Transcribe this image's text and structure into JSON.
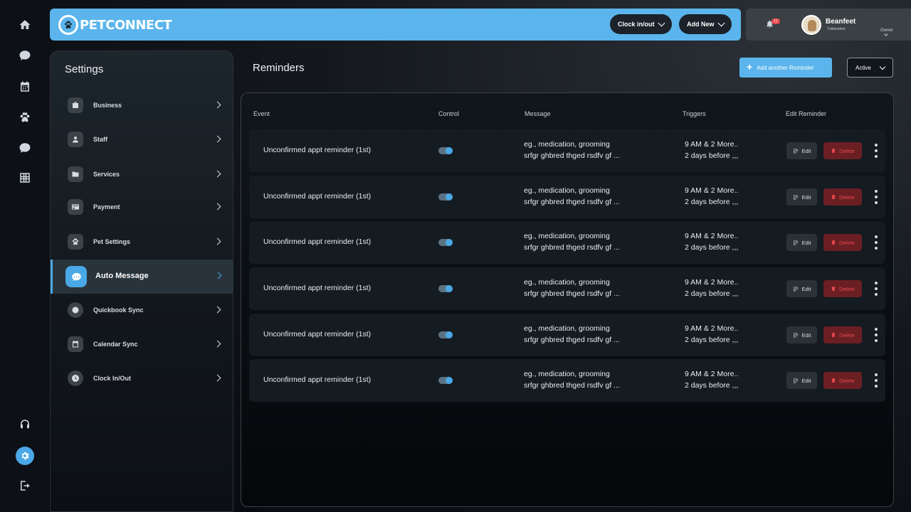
{
  "app": {
    "logo_text_1": "PET",
    "logo_text_2": "CONNECT",
    "accent": "#5bb5ec",
    "danger": "#e5484d"
  },
  "topbar": {
    "clock_label": "Clock in/out",
    "add_new_label": "Add New"
  },
  "user": {
    "notification_count": "12",
    "name": "Beanfeet",
    "location": "Tullamarine",
    "role": "Owner"
  },
  "rail": {
    "icons": [
      "home-icon",
      "chat-icon",
      "calendar-icon",
      "paw-icon",
      "sms-icon",
      "grid-icon",
      "headset-icon",
      "settings-icon",
      "logout-icon"
    ]
  },
  "settings": {
    "title": "Settings",
    "items": [
      {
        "label": "Business",
        "icon": "briefcase-icon"
      },
      {
        "label": "Staff",
        "icon": "person-icon"
      },
      {
        "label": "Services",
        "icon": "folder-icon"
      },
      {
        "label": "Payment",
        "icon": "card-icon"
      },
      {
        "label": "Pet Settings",
        "icon": "paw-icon"
      },
      {
        "label": "Auto Message",
        "icon": "message-icon",
        "active": true
      },
      {
        "label": "Quickbook Sync",
        "icon": "quickbooks-icon"
      },
      {
        "label": "Calendar Sync",
        "icon": "calendar-icon"
      },
      {
        "label": "Clock In/Out",
        "icon": "clock-icon"
      }
    ]
  },
  "reminders": {
    "title": "Reminders",
    "add_label": "Add another Reminder",
    "status_value": "Active",
    "headers": {
      "event": "Event",
      "control": "Control",
      "message": "Message",
      "triggers": "Triggers",
      "edit": "Edit Reminder"
    },
    "edit_label": "Edit",
    "delete_label": "Delete",
    "rows": [
      {
        "event": "Unconfirmed appt reminder (1st)",
        "enabled": true,
        "message_1": "eg., medication, grooming",
        "message_2": "srfgr ghbred thged rsdfv gf ...",
        "trigger_1": "9 AM & 2 More..",
        "trigger_2": "2 days before ,,,"
      },
      {
        "event": "Unconfirmed appt reminder (1st)",
        "enabled": true,
        "message_1": "eg., medication, grooming",
        "message_2": "srfgr ghbred thged rsdfv gf ...",
        "trigger_1": "9 AM & 2 More..",
        "trigger_2": "2 days before ,,,"
      },
      {
        "event": "Unconfirmed appt reminder (1st)",
        "enabled": true,
        "message_1": "eg., medication, grooming",
        "message_2": "srfgr ghbred thged rsdfv gf ...",
        "trigger_1": "9 AM & 2 More..",
        "trigger_2": "2 days before ,,,"
      },
      {
        "event": "Unconfirmed appt reminder (1st)",
        "enabled": true,
        "message_1": "eg., medication, grooming",
        "message_2": "srfgr ghbred thged rsdfv gf ...",
        "trigger_1": "9 AM & 2 More..",
        "trigger_2": "2 days before ,,,"
      },
      {
        "event": "Unconfirmed appt reminder (1st)",
        "enabled": true,
        "message_1": "eg., medication, grooming",
        "message_2": "srfgr ghbred thged rsdfv gf ...",
        "trigger_1": "9 AM & 2 More..",
        "trigger_2": "2 days before ,,,"
      },
      {
        "event": "Unconfirmed appt reminder (1st)",
        "enabled": true,
        "message_1": "eg., medication, grooming",
        "message_2": "srfgr ghbred thged rsdfv gf ...",
        "trigger_1": "9 AM & 2 More..",
        "trigger_2": "2 days before ,,,"
      }
    ]
  }
}
